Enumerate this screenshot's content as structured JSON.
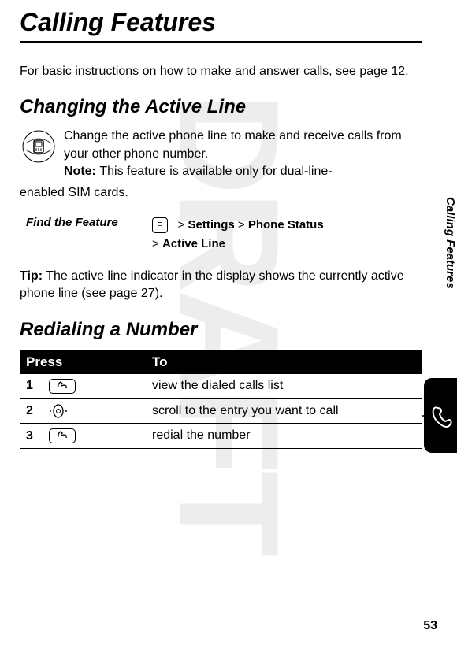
{
  "watermark": "DRAFT",
  "page_title": "Calling Features",
  "intro": "For basic instructions on how to make and answer calls, see page 12.",
  "section1": {
    "heading": "Changing the Active Line",
    "para1": "Change the active phone line to make and receive calls from your other phone number.",
    "note_label": "Note:",
    "note_text": " This feature is available only for dual-line-enabled SIM cards.",
    "feature_label": "Find the Feature",
    "menu_key": "≡",
    "path_parts": {
      "gt1": ">",
      "settings": "Settings",
      "gt2": ">",
      "phone_status": "Phone Status",
      "gt3": ">",
      "active_line": "Active Line"
    },
    "tip_label": "Tip:",
    "tip_text": " The active line indicator in the display shows the currently active phone line (see page 27)."
  },
  "section2": {
    "heading": "Redialing a Number",
    "table": {
      "headers": {
        "press": "Press",
        "to": "To"
      },
      "rows": [
        {
          "num": "1",
          "key_type": "send",
          "action": "view the dialed calls list"
        },
        {
          "num": "2",
          "key_type": "nav",
          "action": "scroll to the entry you want to call"
        },
        {
          "num": "3",
          "key_type": "send",
          "action": "redial the number"
        }
      ]
    }
  },
  "side_tab": "Calling Features",
  "page_number": "53"
}
